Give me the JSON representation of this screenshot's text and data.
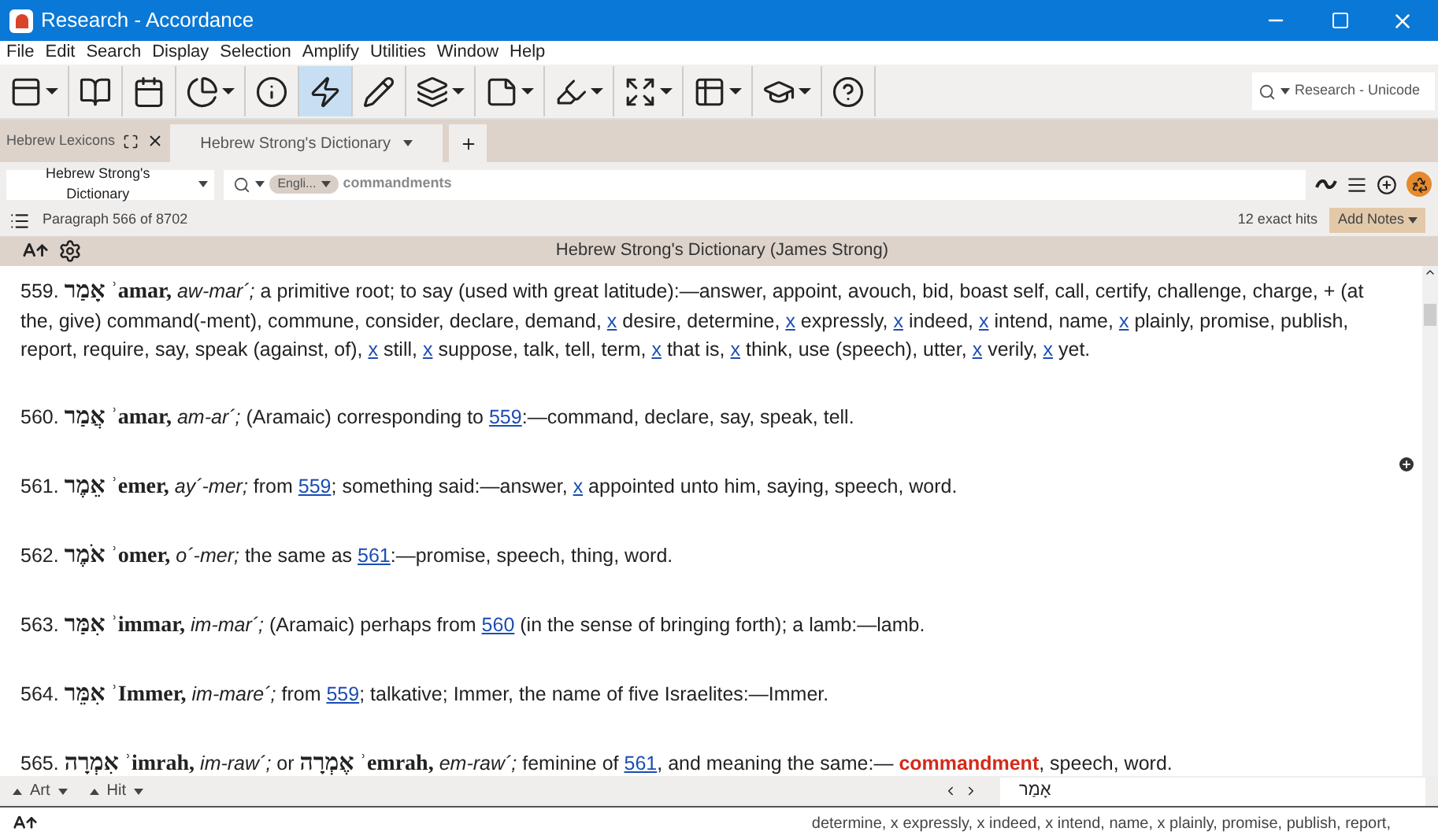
{
  "window": {
    "title": "Research - Accordance"
  },
  "menu": [
    "File",
    "Edit",
    "Search",
    "Display",
    "Selection",
    "Amplify",
    "Utilities",
    "Window",
    "Help"
  ],
  "toolbar": [
    {
      "kind": "layout",
      "dropdown": true,
      "selected": false
    },
    {
      "kind": "library",
      "dropdown": false,
      "selected": false
    },
    {
      "kind": "calendar",
      "dropdown": false,
      "selected": false
    },
    {
      "kind": "chart",
      "dropdown": true,
      "selected": false
    },
    {
      "kind": "info",
      "dropdown": false,
      "selected": false
    },
    {
      "kind": "amplify",
      "dropdown": false,
      "selected": true
    },
    {
      "kind": "pencil",
      "dropdown": false,
      "selected": false
    },
    {
      "kind": "layers",
      "dropdown": true,
      "selected": false
    },
    {
      "kind": "notes",
      "dropdown": true,
      "selected": false
    },
    {
      "kind": "highlight",
      "dropdown": true,
      "selected": false
    },
    {
      "kind": "expand",
      "dropdown": true,
      "selected": false
    },
    {
      "kind": "table",
      "dropdown": true,
      "selected": false
    },
    {
      "kind": "learn",
      "dropdown": true,
      "selected": false
    },
    {
      "kind": "help",
      "dropdown": false,
      "selected": false
    }
  ],
  "global_search": {
    "value": "Research - Unicode"
  },
  "pane": {
    "title": "Hebrew Lexicons"
  },
  "tabs": [
    {
      "label": "Hebrew Strong's Dictionary",
      "selected": true
    }
  ],
  "search_row": {
    "module": "Hebrew Strong's Dictionary",
    "language": "Engli...",
    "query": "commandments"
  },
  "status": {
    "paragraph": "Paragraph 566 of 8702",
    "hits": "12 exact hits",
    "notes_button": "Add Notes"
  },
  "header": {
    "title": "Hebrew Strong's Dictionary (James Strong)"
  },
  "entries": [
    [
      {
        "kind": "num",
        "text": "559."
      },
      {
        "kind": "hebrew",
        "text": "אָמַר"
      },
      {
        "kind": "translit",
        "text": "ʾamar,"
      },
      {
        "kind": "pron",
        "text": "aw-mar´;"
      },
      {
        "kind": "text",
        "text": "a primitive root; to say (used with great latitude):—answer, appoint, avouch, bid, boast self, call, certify, challenge, charge, + (at the, give) command(-ment), commune, consider, declare, demand,"
      },
      {
        "kind": "link",
        "text": "x"
      },
      {
        "kind": "text",
        "text": "desire, determine,"
      },
      {
        "kind": "link",
        "text": "x"
      },
      {
        "kind": "text",
        "text": "expressly,"
      },
      {
        "kind": "link",
        "text": "x"
      },
      {
        "kind": "text",
        "text": "indeed,"
      },
      {
        "kind": "link",
        "text": "x"
      },
      {
        "kind": "text",
        "text": "intend, name,"
      },
      {
        "kind": "link",
        "text": "x"
      },
      {
        "kind": "text",
        "text": "plainly, promise, publish, report, require, say, speak (against, of),"
      },
      {
        "kind": "link",
        "text": "x"
      },
      {
        "kind": "text",
        "text": "still,"
      },
      {
        "kind": "link",
        "text": "x"
      },
      {
        "kind": "text",
        "text": "suppose, talk, tell, term,"
      },
      {
        "kind": "link",
        "text": "x"
      },
      {
        "kind": "text",
        "text": "that is,"
      },
      {
        "kind": "link",
        "text": "x"
      },
      {
        "kind": "text",
        "text": "think, use (speech), utter,"
      },
      {
        "kind": "link",
        "text": "x"
      },
      {
        "kind": "text",
        "text": "verily,"
      },
      {
        "kind": "link",
        "text": "x"
      },
      {
        "kind": "text",
        "text": "yet."
      }
    ],
    [
      {
        "kind": "num",
        "text": "560."
      },
      {
        "kind": "hebrew",
        "text": "אֲמַר"
      },
      {
        "kind": "translit",
        "text": "ʾamar,"
      },
      {
        "kind": "pron",
        "text": "am-ar´;"
      },
      {
        "kind": "text",
        "text": "(Aramaic) corresponding to"
      },
      {
        "kind": "link",
        "text": "559"
      },
      {
        "kind": "glued",
        "text": ":—command, declare, say, speak, tell."
      }
    ],
    [
      {
        "kind": "num",
        "text": "561."
      },
      {
        "kind": "hebrew",
        "text": "אֵמֶר"
      },
      {
        "kind": "translit",
        "text": "ʾemer,"
      },
      {
        "kind": "pron",
        "text": "ay´-mer;"
      },
      {
        "kind": "text",
        "text": "from"
      },
      {
        "kind": "link",
        "text": "559"
      },
      {
        "kind": "glued",
        "text": "; something said:—answer,"
      },
      {
        "kind": "link",
        "text": "x"
      },
      {
        "kind": "text",
        "text": "appointed unto him, saying, speech, word."
      }
    ],
    [
      {
        "kind": "num",
        "text": "562."
      },
      {
        "kind": "hebrew",
        "text": "אֹמֶר"
      },
      {
        "kind": "translit",
        "text": "ʾomer,"
      },
      {
        "kind": "pron",
        "text": "o´-mer;"
      },
      {
        "kind": "text",
        "text": "the same as"
      },
      {
        "kind": "link",
        "text": "561"
      },
      {
        "kind": "glued",
        "text": ":—promise, speech, thing, word."
      }
    ],
    [
      {
        "kind": "num",
        "text": "563."
      },
      {
        "kind": "hebrew",
        "text": "אִמַּר"
      },
      {
        "kind": "translit",
        "text": "ʾimmar,"
      },
      {
        "kind": "pron",
        "text": "im-mar´;"
      },
      {
        "kind": "text",
        "text": "(Aramaic) perhaps from"
      },
      {
        "kind": "link",
        "text": "560"
      },
      {
        "kind": "text",
        "text": "(in the sense of bringing forth); a lamb:—lamb."
      }
    ],
    [
      {
        "kind": "num",
        "text": "564."
      },
      {
        "kind": "hebrew",
        "text": "אִמֵּר"
      },
      {
        "kind": "translit",
        "text": "ʾImmer,"
      },
      {
        "kind": "pron",
        "text": "im-mare´;"
      },
      {
        "kind": "text",
        "text": "from"
      },
      {
        "kind": "link",
        "text": "559"
      },
      {
        "kind": "glued",
        "text": "; talkative; Immer, the name of five Israelites:—Immer."
      }
    ],
    [
      {
        "kind": "num",
        "text": "565."
      },
      {
        "kind": "hebrew",
        "text": "אִמְרָה"
      },
      {
        "kind": "translit",
        "text": "ʾimrah,"
      },
      {
        "kind": "pron",
        "text": "im-raw´;"
      },
      {
        "kind": "text",
        "text": "or"
      },
      {
        "kind": "hebrew",
        "text": "אֶמְרָה"
      },
      {
        "kind": "translit",
        "text": "ʾemrah,"
      },
      {
        "kind": "pron",
        "text": "em-raw´;"
      },
      {
        "kind": "text",
        "text": "feminine of"
      },
      {
        "kind": "link",
        "text": "561"
      },
      {
        "kind": "glued",
        "text": ", and meaning the same:—"
      },
      {
        "kind": "hit",
        "text": "commandment"
      },
      {
        "kind": "glued",
        "text": ", speech, word."
      }
    ]
  ],
  "footer": {
    "art": "Art",
    "hit": "Hit",
    "lookup": "אָמַר"
  },
  "bottom_pane": {
    "text": "determine, x expressly, x indeed, x intend, name, x plainly, promise, publish, report,"
  }
}
